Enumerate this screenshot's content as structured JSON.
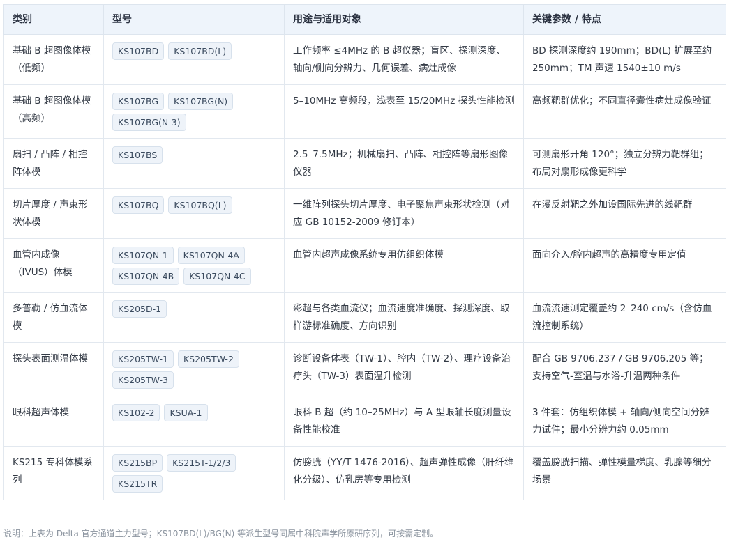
{
  "headers": [
    "类别",
    "型号",
    "用途与适用对象",
    "关键参数 / 特点"
  ],
  "rows": [
    {
      "category": "基础 B 超图像体模（低频）",
      "models": [
        "KS107BD",
        "KS107BD(L)"
      ],
      "usage": "工作频率 ≤4MHz 的 B 超仪器；盲区、探测深度、轴向/侧向分辨力、几何误差、病灶成像",
      "params": "BD 探测深度约 190mm；BD(L) 扩展至约 250mm；TM 声速 1540±10 m/s"
    },
    {
      "category": "基础 B 超图像体模（高频）",
      "models": [
        "KS107BG",
        "KS107BG(N)",
        "KS107BG(N-3)"
      ],
      "usage": "5–10MHz 高频段，浅表至 15/20MHz 探头性能检测",
      "params": "高频靶群优化；不同直径囊性病灶成像验证"
    },
    {
      "category": "扇扫 / 凸阵 / 相控阵体模",
      "models": [
        "KS107BS"
      ],
      "usage": "2.5–7.5MHz；机械扇扫、凸阵、相控阵等扇形图像仪器",
      "params": "可测扇形开角 120°；独立分辨力靶群组；布局对扇形成像更科学"
    },
    {
      "category": "切片厚度 / 声束形状体模",
      "models": [
        "KS107BQ",
        "KS107BQ(L)"
      ],
      "usage": "一维阵列探头切片厚度、电子聚焦声束形状检测（对应 GB 10152-2009 修订本）",
      "params": "在漫反射靶之外加设国际先进的线靶群"
    },
    {
      "category": "血管内成像（IVUS）体模",
      "models": [
        "KS107QN-1",
        "KS107QN-4A",
        "KS107QN-4B",
        "KS107QN-4C"
      ],
      "usage": "血管内超声成像系统专用仿组织体模",
      "params": "面向介入/腔内超声的高精度专用定值"
    },
    {
      "category": "多普勒 / 仿血流体模",
      "models": [
        "KS205D-1"
      ],
      "usage": "彩超与各类血流仪；血流速度准确度、探测深度、取样游标准确度、方向识别",
      "params": "血流流速测定覆盖约 2–240 cm/s（含仿血流控制系统）"
    },
    {
      "category": "探头表面测温体模",
      "models": [
        "KS205TW-1",
        "KS205TW-2",
        "KS205TW-3"
      ],
      "usage": "诊断设备体表（TW-1）、腔内（TW-2）、理疗设备治疗头（TW-3）表面温升检测",
      "params": "配合 GB 9706.237 / GB 9706.205 等；支持空气-室温与水浴-升温两种条件"
    },
    {
      "category": "眼科超声体模",
      "models": [
        "KS102-2",
        "KSUA-1"
      ],
      "usage": "眼科 B 超（约 10–25MHz）与 A 型眼轴长度测量设备性能校准",
      "params": "3 件套：仿组织体模 + 轴向/侧向空间分辨力试件；最小分辨力约 0.05mm"
    },
    {
      "category": "KS215 专科体模系列",
      "models": [
        "KS215BP",
        "KS215T-1/2/3",
        "KS215TR"
      ],
      "usage": "仿膀胱（YY/T 1476-2016）、超声弹性成像（肝纤维化分级）、仿乳房等专用检测",
      "params": "覆盖膀胱扫描、弹性模量梯度、乳腺等细分场景"
    }
  ],
  "note": "说明：上表为 Delta 官方通道主力型号；KS107BD(L)/BG(N) 等派生型号同属中科院声学所原研序列，可按需定制。"
}
